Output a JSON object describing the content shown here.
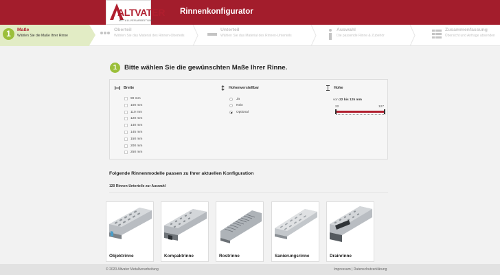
{
  "header": {
    "logo": "ALTVATER",
    "logo_sub": "METALLVERARBEITUNG",
    "title": "Rinnenkonfigurator"
  },
  "steps": [
    {
      "num": "1",
      "title": "Maße",
      "subtitle": "Wählen Sie die Maße Ihrer Rinne",
      "icon": "number-one"
    },
    {
      "title": "Oberteil",
      "subtitle": "Wählen Sie das Material des Rinnen-Oberteils",
      "icon": "dots-icon"
    },
    {
      "title": "Unterteil",
      "subtitle": "Wählen Sie das Material des Rinnen-Unterteils",
      "icon": "bar-icon"
    },
    {
      "title": "Auswahl",
      "subtitle": "Die passende Rinne & Zubehör",
      "icon": "info-icon"
    },
    {
      "title": "Zusammenfassung",
      "subtitle": "Übersicht und Anfrage absenden",
      "icon": "list-icon"
    }
  ],
  "main": {
    "step_num": "1",
    "heading": "Bitte wählen Sie die gewünschten Maße Ihrer Rinne."
  },
  "config": {
    "breite": {
      "label": "Breite",
      "icon": "width-icon",
      "options": [
        "90 mm",
        "100 mm",
        "110 mm",
        "120 mm",
        "140 mm",
        "145 mm",
        "150 mm",
        "200 mm",
        "250 mm"
      ]
    },
    "hohenverstellbar": {
      "label": "Hohenverstellbar",
      "icon": "vertical-arrows-icon",
      "options": [
        "Ja",
        "Nein",
        "Optional"
      ],
      "selected": "Optional"
    },
    "hohe": {
      "label": "Hohe",
      "icon": "height-icon",
      "range_prefix": "von",
      "range_bold": "22 bis 125 mm",
      "min_label": "22",
      "max_label": "127",
      "min": 22,
      "max": 127,
      "value_from": 22,
      "value_to": 125,
      "accent": "#b01e2e"
    }
  },
  "results": {
    "heading": "Folgende Rinnenmodelle passen zu Ihrer aktuellen Konfiguration",
    "count_text": "120 Rinnen-Unterteile zur Auswahl",
    "cards": [
      {
        "label": "Objektrinne"
      },
      {
        "label": "Kompaktrinne"
      },
      {
        "label": "Rostrinne"
      },
      {
        "label": "Sanierungsrinne"
      },
      {
        "label": "Drainrinne"
      }
    ]
  },
  "footer": {
    "copyright": "© 2020 Altvater Metallverarbeitung",
    "links": "Impressum | Datenschutzerklärung"
  },
  "colors": {
    "brand": "#a31d2c",
    "step_active_bg": "#e2ecc5",
    "step_badge": "#9bbf3a"
  }
}
